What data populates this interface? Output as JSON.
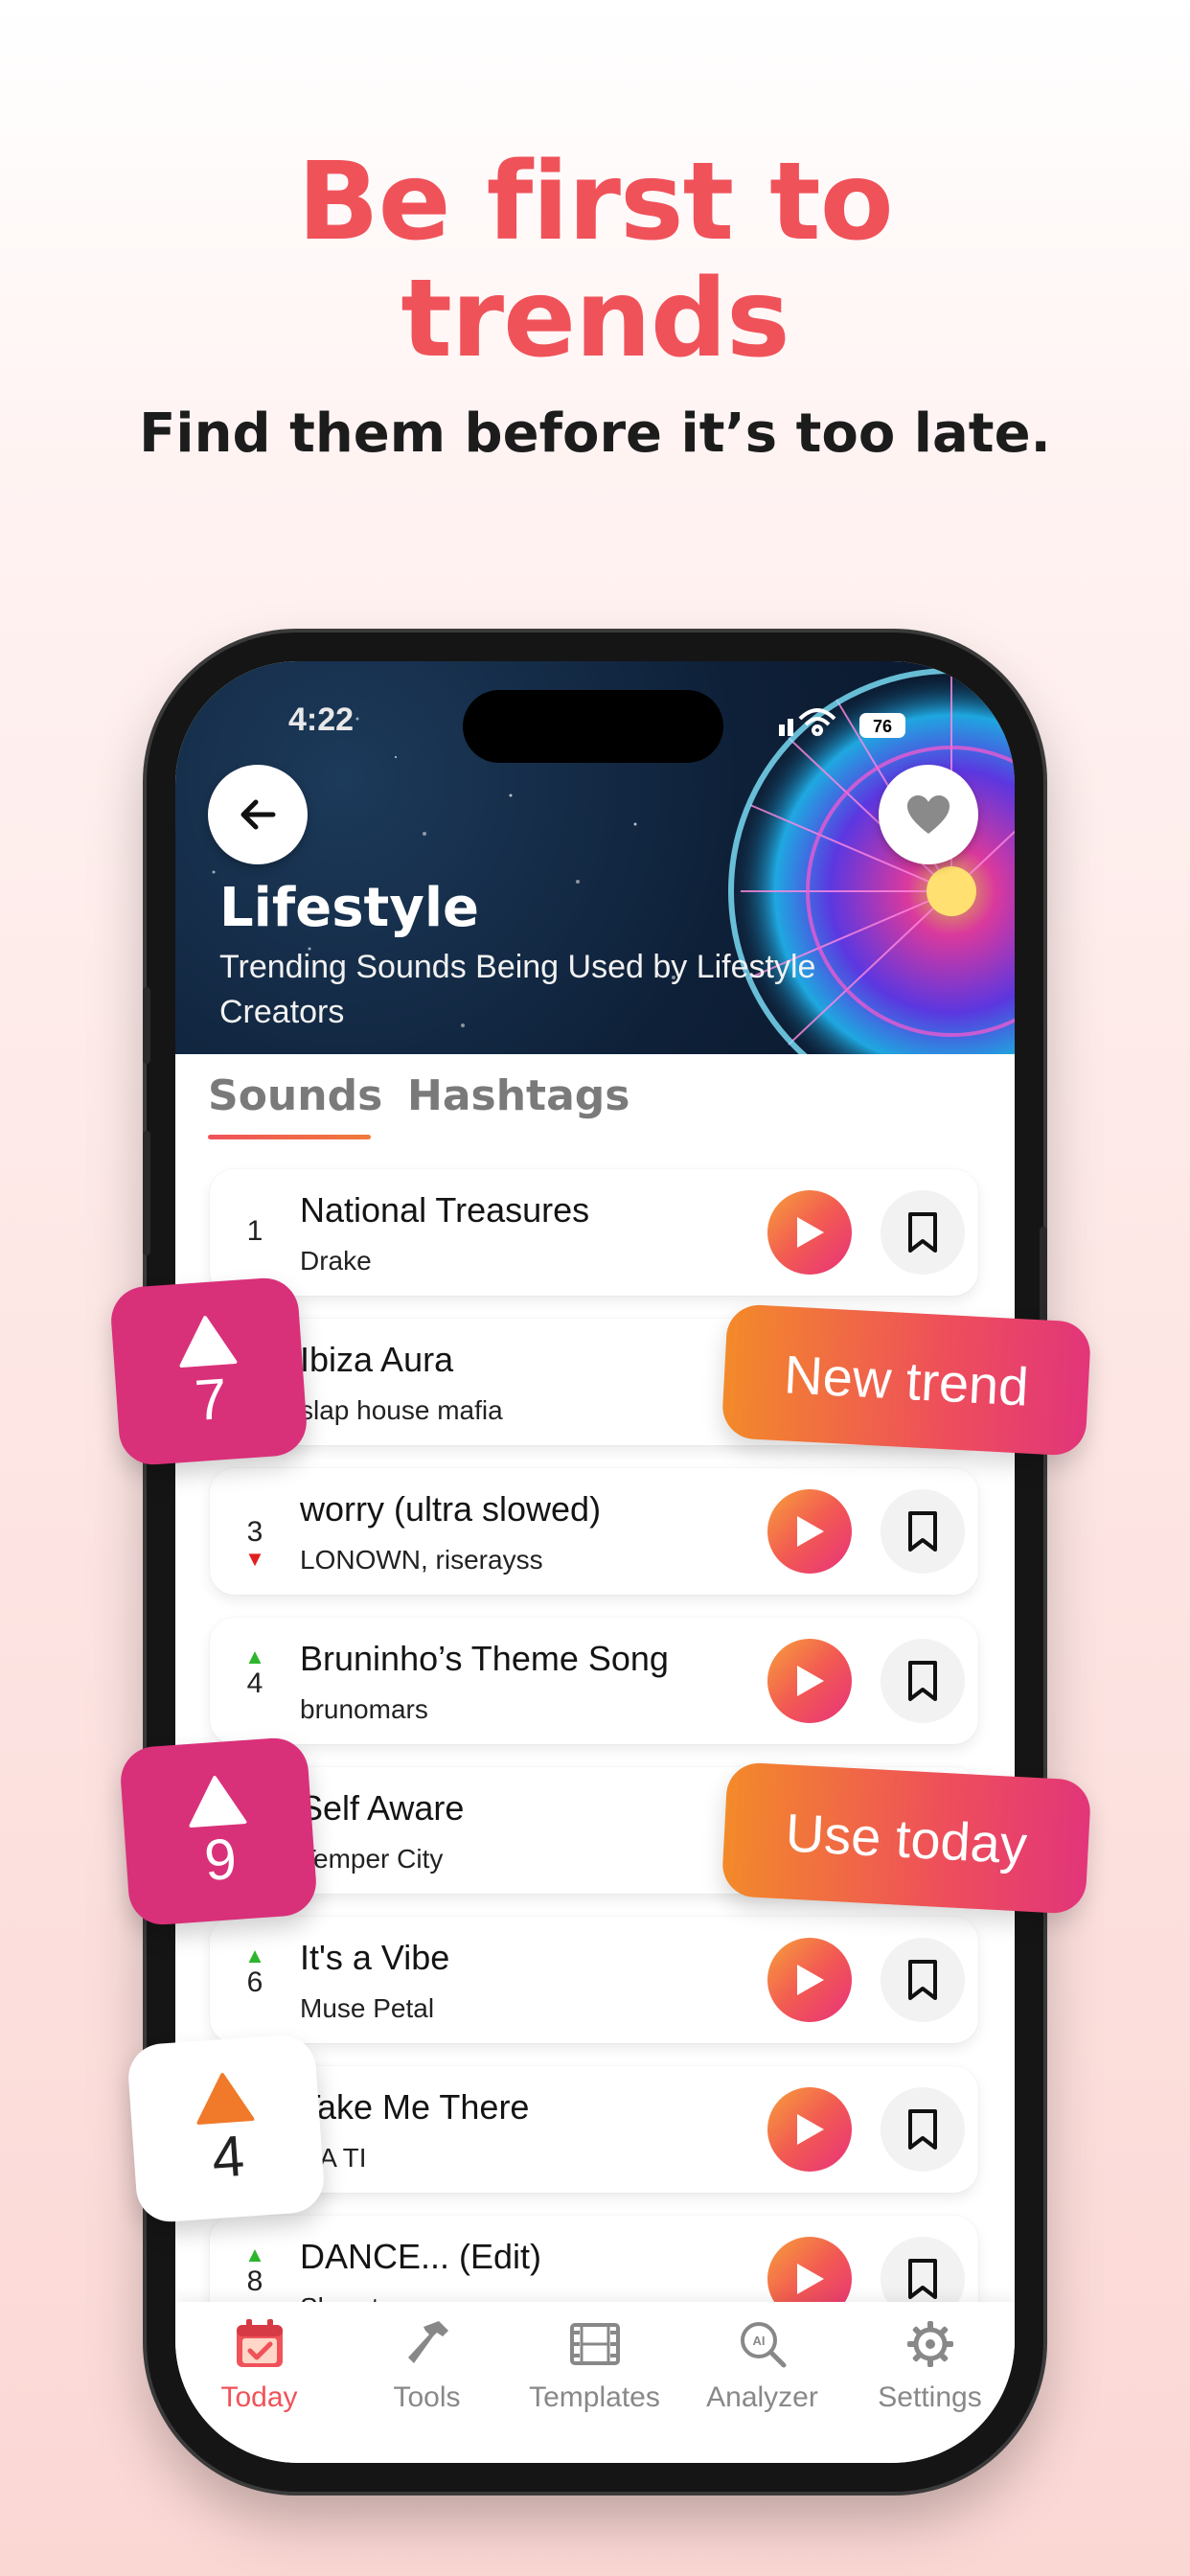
{
  "headline": {
    "line1": "Be first to",
    "line2": "trends",
    "sub": "Find them before it’s too late."
  },
  "status": {
    "time": "4:22",
    "battery": "76"
  },
  "hero": {
    "title": "Lifestyle",
    "subtitle": "Trending Sounds Being Used by Lifestyle Creators"
  },
  "tabs": [
    {
      "label": "Sounds",
      "active": true
    },
    {
      "label": "Hashtags",
      "active": false
    }
  ],
  "songs": [
    {
      "rank": "1",
      "trend": "",
      "title": "National Treasures",
      "artist": "Drake"
    },
    {
      "rank": "7",
      "trend": "up",
      "title": "Ibiza Aura",
      "artist": "slap house mafia"
    },
    {
      "rank": "3",
      "trend": "down",
      "title": "worry (ultra slowed)",
      "artist": "LONOWN, riserayss"
    },
    {
      "rank": "4",
      "trend": "up",
      "title": "Bruninho’s Theme Song",
      "artist": "brunomars"
    },
    {
      "rank": "9",
      "trend": "up",
      "title": "Self Aware",
      "artist": "Temper City"
    },
    {
      "rank": "6",
      "trend": "up",
      "title": "It's a Vibe",
      "artist": "Muse Petal"
    },
    {
      "rank": "4",
      "trend": "up",
      "title": "Take Me There",
      "artist": "DA TI"
    },
    {
      "rank": "8",
      "trend": "up",
      "title": "DANCE... (Edit)",
      "artist": "Slowster"
    }
  ],
  "overlays": {
    "badge1": "7",
    "badge2": "9",
    "badge3": "4",
    "pill1": "New trend",
    "pill2": "Use today"
  },
  "nav": [
    {
      "label": "Today",
      "icon": "calendar-check-icon",
      "active": true
    },
    {
      "label": "Tools",
      "icon": "hammer-icon",
      "active": false
    },
    {
      "label": "Templates",
      "icon": "film-icon",
      "active": false
    },
    {
      "label": "Analyzer",
      "icon": "ai-search-icon",
      "active": false
    },
    {
      "label": "Settings",
      "icon": "gear-icon",
      "active": false
    }
  ],
  "colors": {
    "accent": "#f0525a",
    "badge": "#d9307a",
    "trend_up": "#2db52d",
    "trend_down": "#e02020"
  }
}
